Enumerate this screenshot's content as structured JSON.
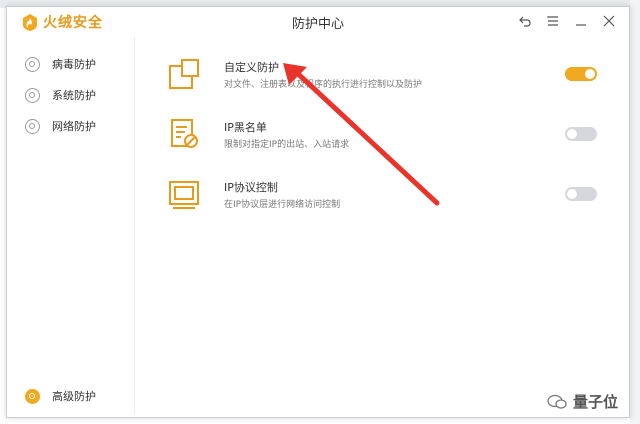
{
  "app": {
    "logo_text": "火绒安全",
    "title": "防护中心",
    "brand_color": "#f0a920"
  },
  "window_controls": {
    "back_icon": "back-arrow-icon",
    "menu_icon": "menu-icon",
    "minimize_icon": "minimize-icon",
    "close_icon": "close-icon"
  },
  "sidebar": {
    "items": [
      {
        "label": "病毒防护",
        "icon": "virus-protection-icon"
      },
      {
        "label": "系统防护",
        "icon": "system-protection-icon"
      },
      {
        "label": "网络防护",
        "icon": "network-protection-icon"
      }
    ],
    "bottom_item": {
      "label": "高级防护",
      "icon": "advanced-protection-icon",
      "active": true
    }
  },
  "features": [
    {
      "title": "自定义防护",
      "description": "对文件、注册表以及程序的执行进行控制以及防护",
      "enabled": true,
      "icon": "custom-protection-icon"
    },
    {
      "title": "IP黑名单",
      "description": "限制对指定IP的出站、入站请求",
      "enabled": false,
      "icon": "ip-blacklist-icon"
    },
    {
      "title": "IP协议控制",
      "description": "在IP协议层进行网络访问控制",
      "enabled": false,
      "icon": "ip-protocol-icon"
    }
  ],
  "watermark": {
    "text": "量子位",
    "icon": "wechat-icon"
  }
}
